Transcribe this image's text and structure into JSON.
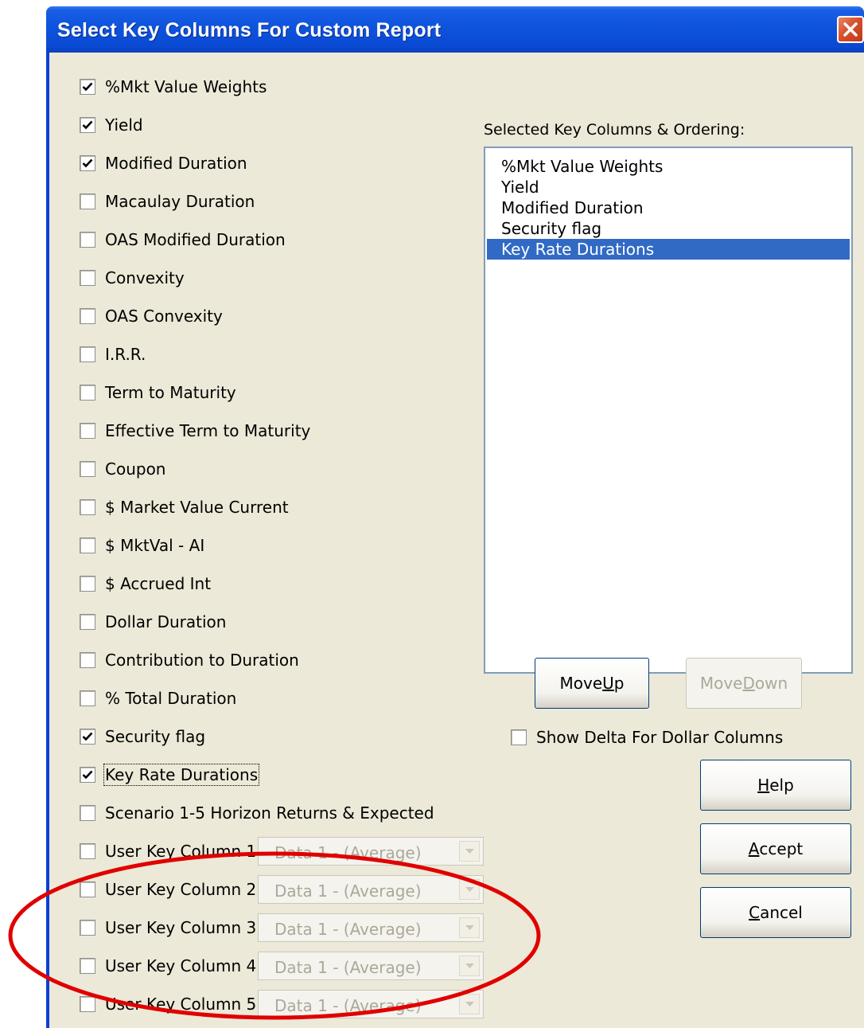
{
  "window": {
    "title": "Select Key Columns For Custom Report"
  },
  "checkboxes": [
    {
      "label": "%Mkt Value Weights",
      "checked": true
    },
    {
      "label": "Yield",
      "checked": true
    },
    {
      "label": "Modified Duration",
      "checked": true
    },
    {
      "label": "Macaulay Duration",
      "checked": false
    },
    {
      "label": "OAS Modified Duration",
      "checked": false
    },
    {
      "label": "Convexity",
      "checked": false
    },
    {
      "label": "OAS Convexity",
      "checked": false
    },
    {
      "label": "I.R.R.",
      "checked": false
    },
    {
      "label": "Term to Maturity",
      "checked": false
    },
    {
      "label": "Effective Term to Maturity",
      "checked": false
    },
    {
      "label": "Coupon",
      "checked": false
    },
    {
      "label": "$ Market Value Current",
      "checked": false
    },
    {
      "label": "$ MktVal - AI",
      "checked": false
    },
    {
      "label": "$ Accrued Int",
      "checked": false
    },
    {
      "label": "Dollar Duration",
      "checked": false
    },
    {
      "label": "Contribution to Duration",
      "checked": false
    },
    {
      "label": "% Total Duration",
      "checked": false
    },
    {
      "label": "Security flag",
      "checked": true
    },
    {
      "label": "Key Rate Durations",
      "checked": true
    },
    {
      "label": "Scenario 1-5 Horizon Returns & Expected",
      "checked": false
    }
  ],
  "user_columns": [
    {
      "label": "User Key Column 1",
      "checked": false,
      "value": "Data 1 - (Average)"
    },
    {
      "label": "User Key Column 2",
      "checked": false,
      "value": "Data 1 - (Average)"
    },
    {
      "label": "User Key Column 3",
      "checked": false,
      "value": "Data 1 - (Average)"
    },
    {
      "label": "User Key Column 4",
      "checked": false,
      "value": "Data 1 - (Average)"
    },
    {
      "label": "User Key Column 5",
      "checked": false,
      "value": "Data 1 - (Average)"
    }
  ],
  "selected_panel": {
    "label": "Selected Key Columns & Ordering:",
    "items": [
      "%Mkt Value Weights",
      "Yield",
      "Modified Duration",
      "Security flag",
      "Key Rate Durations"
    ],
    "selected_index": 4
  },
  "buttons": {
    "move_up": {
      "pre": "Move ",
      "key": "U",
      "post": "p"
    },
    "move_down": {
      "pre": "Move ",
      "key": "D",
      "post": "own"
    },
    "help": {
      "pre": "",
      "key": "H",
      "post": "elp"
    },
    "accept": {
      "pre": "",
      "key": "A",
      "post": "ccept"
    },
    "cancel": {
      "pre": "",
      "key": "C",
      "post": "ancel"
    }
  },
  "show_delta": {
    "label": "Show Delta For Dollar Columns",
    "checked": false
  },
  "colors": {
    "title_bar": "#0a4ad4",
    "dialog_bg": "#ece9d8",
    "selection": "#316ac5",
    "annotation": "#e00000"
  }
}
